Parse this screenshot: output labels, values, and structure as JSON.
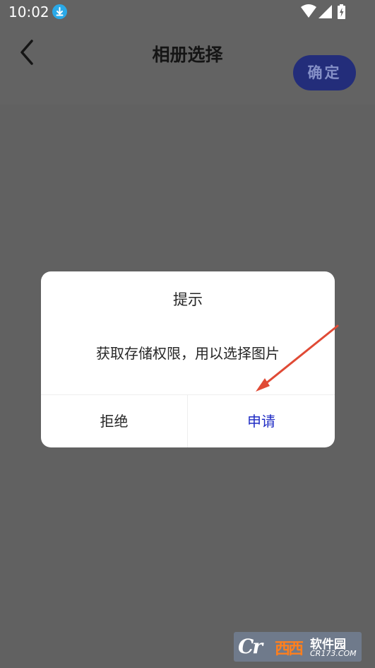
{
  "status_bar": {
    "time": "10:02",
    "icons": [
      "download-icon",
      "wifi-icon",
      "signal-icon",
      "battery-charging-icon"
    ]
  },
  "header": {
    "title": "相册选择",
    "confirm_label": "确定",
    "back_icon": "chevron-left-icon"
  },
  "dialog": {
    "title": "提示",
    "message": "获取存储权限，用以选择图片",
    "deny_label": "拒绝",
    "apply_label": "申请"
  },
  "annotation": {
    "arrow_color": "#e04a35"
  },
  "watermark": {
    "logo": "Cr",
    "brand": "西西",
    "name": "软件园",
    "domain": "CR173.COM"
  },
  "colors": {
    "overlay": "#626262",
    "confirm_bg": "#232d7a",
    "confirm_text": "#8590c7",
    "apply_text": "#1f2bc4"
  }
}
